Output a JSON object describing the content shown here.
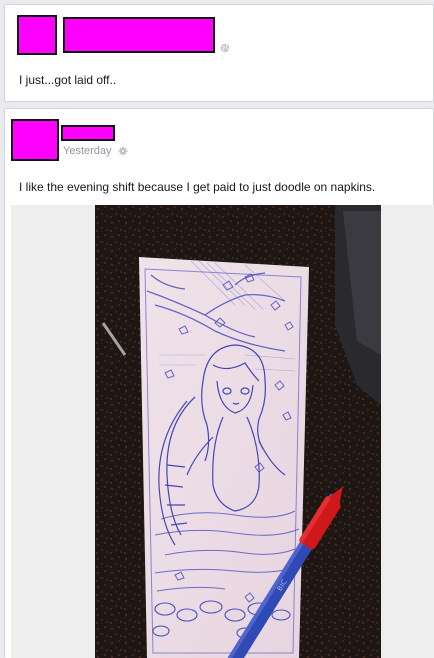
{
  "post1": {
    "text": "I just...got laid off.."
  },
  "post2": {
    "timestamp": "Yesterday",
    "text": "I like the evening shift because I get paid to just doodle on napkins."
  },
  "icons": {
    "privacy": "globe-icon",
    "audience": "gear-icon"
  },
  "colors": {
    "redaction": "#ff00ff",
    "page_bg": "#e9eaed",
    "meta_text": "#9197a3"
  }
}
